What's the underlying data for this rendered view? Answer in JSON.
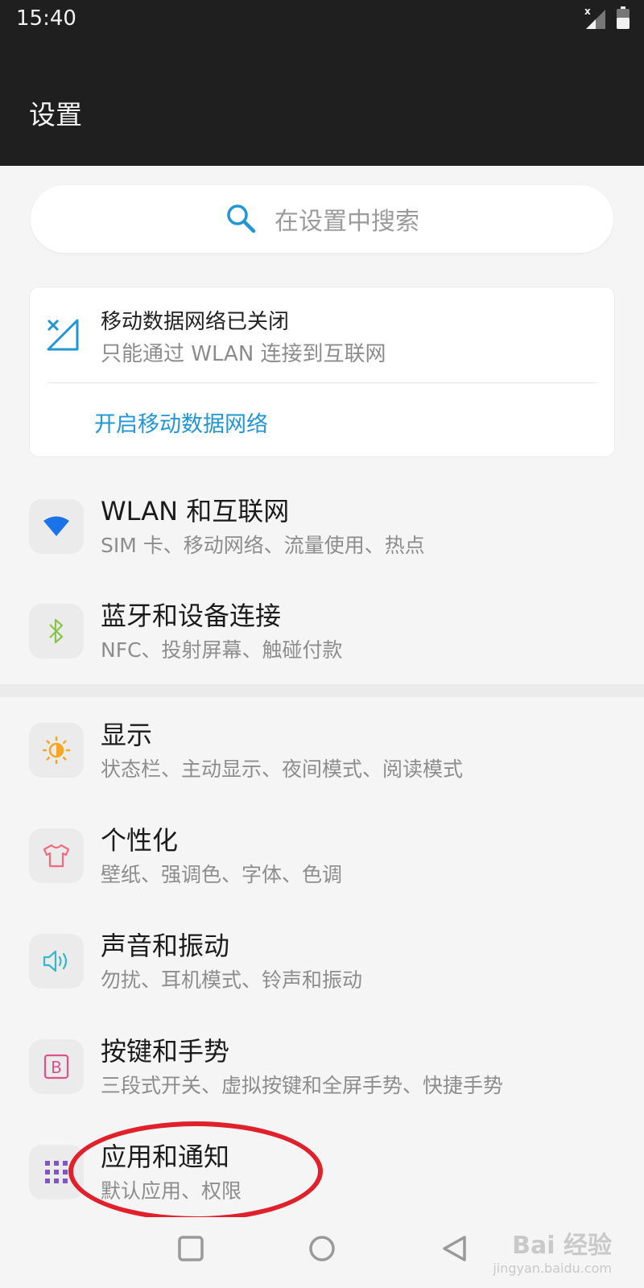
{
  "status_bar": {
    "time": "15:40"
  },
  "header": {
    "title": "设置"
  },
  "search": {
    "placeholder": "在设置中搜索"
  },
  "notice_card": {
    "title": "移动数据网络已关闭",
    "subtitle": "只能通过 WLAN 连接到互联网",
    "action": "开启移动数据网络"
  },
  "settings_items": [
    {
      "title": "WLAN 和互联网",
      "subtitle": "SIM 卡、移动网络、流量使用、热点",
      "icon": "wifi-icon",
      "color": "#1a73e8"
    },
    {
      "title": "蓝牙和设备连接",
      "subtitle": "NFC、投射屏幕、触碰付款",
      "icon": "bluetooth-icon",
      "color": "#8bc34a"
    },
    {
      "title": "显示",
      "subtitle": "状态栏、主动显示、夜间模式、阅读模式",
      "icon": "brightness-icon",
      "color": "#f6a623"
    },
    {
      "title": "个性化",
      "subtitle": "壁纸、强调色、字体、色调",
      "icon": "tshirt-icon",
      "color": "#f26b7a"
    },
    {
      "title": "声音和振动",
      "subtitle": "勿扰、耳机模式、铃声和振动",
      "icon": "speaker-icon",
      "color": "#37b6c8"
    },
    {
      "title": "按键和手势",
      "subtitle": "三段式开关、虚拟按键和全屏手势、快捷手势",
      "icon": "button-b-icon",
      "color": "#e0508a"
    },
    {
      "title": "应用和通知",
      "subtitle": "默认应用、权限",
      "icon": "apps-grid-icon",
      "color": "#7e57c2"
    }
  ],
  "watermark": {
    "brand": "Bai 经验",
    "url": "jingyan.baidu.com"
  }
}
